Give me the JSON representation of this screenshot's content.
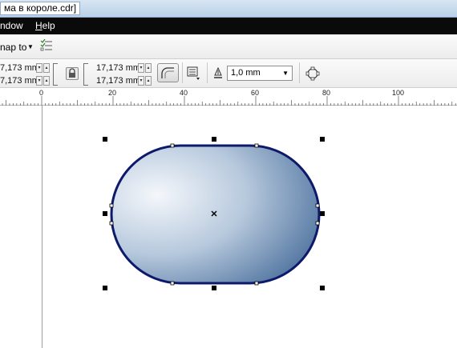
{
  "window": {
    "title": "ма в короле.cdr]"
  },
  "menu": {
    "window_label_pre": "",
    "window_label_u": "",
    "window_label": "ndow",
    "help_u": "H",
    "help_rest": "elp"
  },
  "toolbar": {
    "snap_label": "nap to",
    "snap_dropdown": "▼"
  },
  "property_bar": {
    "width_value": "7,173 mm",
    "height_value": "7,173 mm",
    "corner_w_value": "17,173 mm",
    "corner_h_value": "17,173 mm",
    "outline_width": "1,0 mm",
    "outline_dropdown": "▼"
  },
  "ruler": {
    "labels": [
      "0",
      "20",
      "40",
      "60",
      "80",
      "100"
    ]
  },
  "colors": {
    "shape_outline": "#0d1a6b",
    "gradient_light": "#f4f7fb",
    "gradient_dark": "#3d6494",
    "menubar_bg": "#0a0a0a"
  }
}
